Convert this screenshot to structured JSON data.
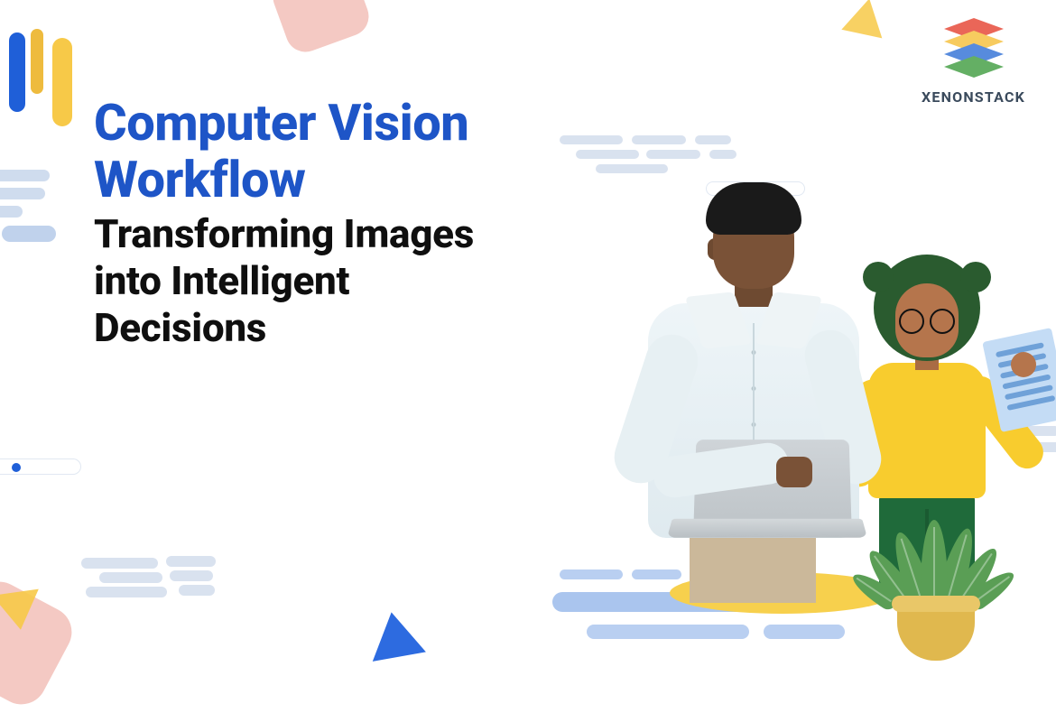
{
  "headline": {
    "title_line1": "Computer Vision",
    "title_line2": "Workflow",
    "subtitle_line1": "Transforming Images",
    "subtitle_line2": "into Intelligent",
    "subtitle_line3": "Decisions"
  },
  "logo": {
    "brand_name": "XENONSTACK",
    "layer_colors": [
      "#e74c3c",
      "#f6c244",
      "#3a77d8",
      "#4aa24a"
    ]
  },
  "illustration": {
    "foreground_person": "man-holding-laptop",
    "background_person": "woman-with-tablet",
    "prop": "potted-plant"
  },
  "palette": {
    "title_blue": "#1e55c7",
    "accent_yellow": "#f7c948",
    "accent_pink": "#f4c9c3",
    "capsule_grey": "#d9e2ef"
  }
}
